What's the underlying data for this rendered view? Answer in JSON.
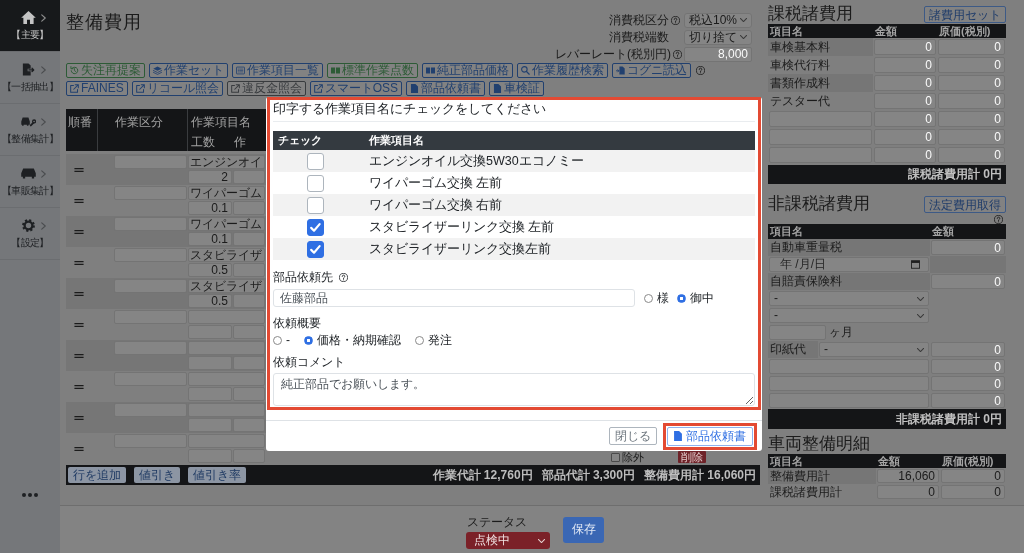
{
  "sidebar": {
    "items": [
      {
        "label": "【主要】",
        "kind": "home",
        "selected": true
      },
      {
        "label": "【一括抽出】",
        "kind": "export",
        "selected": false
      },
      {
        "label": "【整備集計】",
        "kind": "repair",
        "selected": false
      },
      {
        "label": "【車販集計】",
        "kind": "car",
        "selected": false
      },
      {
        "label": "【設定】",
        "kind": "settings",
        "selected": false
      }
    ]
  },
  "page": {
    "title": "整備費用"
  },
  "tax_settings": [
    {
      "label": "消費税区分",
      "help": true,
      "kind": "select",
      "value": "税込10%"
    },
    {
      "label": "消費税端数",
      "kind": "select",
      "value": "切り捨て"
    },
    {
      "label": "レバーレート(税別円)",
      "help": true,
      "kind": "input",
      "placeholder": "8,000"
    }
  ],
  "toolbar": {
    "rows": [
      {
        "help": true,
        "buttons": [
          {
            "label": "失注再提案",
            "kind": "history",
            "color": "#2d5b36"
          },
          {
            "label": "作業セット",
            "kind": "stack",
            "color": "#21406f"
          },
          {
            "label": "作業項目一覧",
            "kind": "list",
            "color": "#21406f"
          },
          {
            "label": "標準作業点数",
            "kind": "book",
            "color": "#2d5b36"
          },
          {
            "label": "純正部品価格",
            "kind": "book",
            "color": "#21406f"
          },
          {
            "label": "作業履歴検索",
            "kind": "search",
            "color": "#21406f"
          },
          {
            "label": "コグニ読込",
            "kind": "import",
            "color": "#21406f"
          }
        ]
      },
      {
        "buttons": [
          {
            "label": "FAINES",
            "kind": "external",
            "color": "#21406f"
          },
          {
            "label": "リコール照会",
            "kind": "external",
            "color": "#21406f"
          },
          {
            "label": "違反金照会",
            "kind": "external",
            "color": "#383b3e"
          },
          {
            "label": "スマートOSS",
            "kind": "external",
            "color": "#21406f"
          },
          {
            "label": "部品依頼書",
            "kind": "pdf",
            "color": "#21406f"
          },
          {
            "label": "車検証",
            "kind": "pdf",
            "color": "#21406f"
          }
        ]
      }
    ]
  },
  "work_table": {
    "columns": [
      "順番",
      "作業区分",
      "作業項目名"
    ],
    "subcolumns": [
      "工数",
      "作"
    ],
    "rows": [
      {
        "name": "エンジンオイ",
        "hours": "2"
      },
      {
        "name": "ワイパーゴム",
        "hours": "0.1"
      },
      {
        "name": "ワイパーゴム",
        "hours": "0.1"
      },
      {
        "name": "スタビライザ",
        "hours": "0.5"
      },
      {
        "name": "スタビライザ",
        "hours": "0.5"
      },
      {},
      {},
      {},
      {},
      {
        "exclude": {
          "label": "除外",
          "checked": false
        },
        "delete_button": "削除"
      }
    ]
  },
  "dialog": {
    "highlighted": true,
    "title": "印字する作業項目名にチェックをしてください",
    "columns": [
      "チェック",
      "作業項目名"
    ],
    "items": [
      {
        "name": "エンジンオイル交換5W30エコノミー",
        "checked": false
      },
      {
        "name": "ワイパーゴム交換 左前",
        "checked": false
      },
      {
        "name": "ワイパーゴム交換 右前",
        "checked": false
      },
      {
        "name": "スタビライザーリンク交換 左前",
        "checked": true
      },
      {
        "name": "スタビライザーリンク交換左前",
        "checked": true
      }
    ],
    "supplier": {
      "label": "部品依頼先",
      "help": true,
      "value": "佐藤部品",
      "honorifics": [
        {
          "label": "様",
          "selected": false
        },
        {
          "label": "御中",
          "selected": true
        }
      ]
    },
    "request_type": {
      "label": "依頼概要",
      "options": [
        {
          "label": "-",
          "selected": false
        },
        {
          "label": "価格・納期確認",
          "selected": true
        },
        {
          "label": "発注",
          "selected": false
        }
      ]
    },
    "comment": {
      "label": "依頼コメント",
      "value": "純正部品でお願いします。"
    },
    "buttons": [
      {
        "label": "閉じる",
        "kind": "secondary"
      },
      {
        "label": "部品依頼書",
        "kind": "primary",
        "highlighted": true
      }
    ]
  },
  "work_footer": {
    "buttons": [
      "行を追加",
      "値引き",
      "値引き率"
    ],
    "totals": [
      "作業代計 12,760円",
      "部品代計 3,300円",
      "整備費用計 16,060円"
    ]
  },
  "taxable_fees": {
    "title": "課税諸費用",
    "button": "諸費用セット",
    "columns": [
      "項目名",
      "金額",
      "原価(税別)"
    ],
    "rows": [
      {
        "name": "車検基本料",
        "amount": {
          "placeholder": "0"
        },
        "cost": {
          "placeholder": "0"
        }
      },
      {
        "name": "車検代行料",
        "amount": {
          "placeholder": "0"
        },
        "cost": {
          "placeholder": "0"
        }
      },
      {
        "name": "書類作成料",
        "amount": {
          "placeholder": "0"
        },
        "cost": {
          "placeholder": "0"
        }
      },
      {
        "name": "テスター代",
        "amount": {
          "placeholder": "0"
        },
        "cost": {
          "placeholder": "0"
        }
      },
      {
        "amount": {
          "placeholder": "0"
        },
        "cost": {
          "placeholder": "0"
        }
      },
      {
        "amount": {
          "placeholder": "0"
        },
        "cost": {
          "placeholder": "0"
        }
      },
      {
        "amount": {
          "placeholder": "0"
        },
        "cost": {
          "placeholder": "0"
        }
      }
    ],
    "total": "課税諸費用計 0円"
  },
  "nontaxable_fees": {
    "title": "非課税諸費用",
    "button": "法定費用取得",
    "help": true,
    "columns": [
      "項目名",
      "金額"
    ],
    "rows": [
      {
        "kind": "label",
        "name": "自動車重量税",
        "amount": {
          "placeholder": "0"
        }
      },
      {
        "kind": "date",
        "placeholder": "年 /月/日"
      },
      {
        "kind": "label",
        "name": "自賠責保険料",
        "amount": {
          "placeholder": "0"
        }
      },
      {
        "kind": "select",
        "value": "-"
      },
      {
        "kind": "select",
        "value": "-"
      },
      {
        "kind": "months",
        "unit": "ヶ月"
      },
      {
        "kind": "label_select",
        "name": "印紙代",
        "option": "-",
        "amount": {
          "placeholder": "0"
        }
      },
      {
        "kind": "input",
        "amount": {
          "placeholder": "0"
        }
      },
      {
        "kind": "input",
        "amount": {
          "placeholder": "0"
        }
      },
      {
        "kind": "input",
        "amount": {
          "placeholder": "0"
        }
      }
    ],
    "total": "非課税諸費用計 0円"
  },
  "maintenance_detail": {
    "title": "車両整備明細",
    "columns": [
      "項目名",
      "金額",
      "原価(税別)"
    ],
    "rows": [
      {
        "name": "整備費用計",
        "amount": "16,060",
        "cost": "0"
      },
      {
        "name": "課税諸費用計",
        "amount": "0",
        "cost": "0"
      }
    ]
  },
  "status_bar": {
    "label": "ステータス",
    "value": "点検中",
    "save_button": "保存"
  }
}
